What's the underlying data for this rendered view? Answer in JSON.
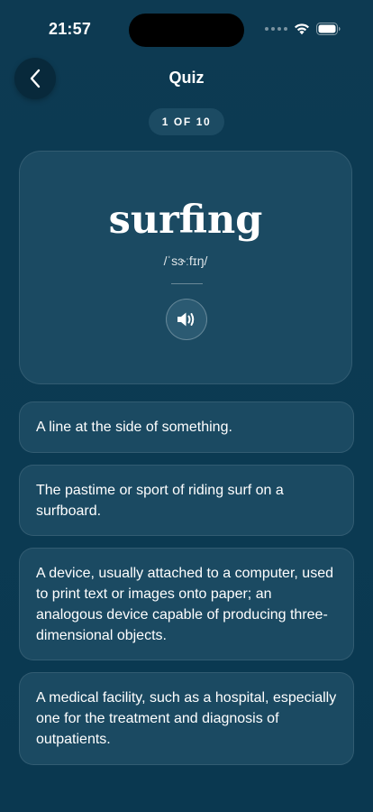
{
  "status_bar": {
    "time": "21:57"
  },
  "header": {
    "title": "Quiz",
    "progress": "1 OF 10"
  },
  "card": {
    "word": "surfing",
    "pronunciation": "/ˈsɝːfɪŋ/"
  },
  "options": [
    {
      "text": "A line at the side of something."
    },
    {
      "text": "The pastime or sport of riding surf on a surfboard."
    },
    {
      "text": "A device, usually attached to a computer, used to print text or images onto paper; an analogous device capable of producing three-dimensional objects."
    },
    {
      "text": "A medical facility, such as a hospital, especially one for the treatment and diagnosis of outpatients."
    }
  ],
  "icons": {
    "back": "chevron-left-icon",
    "speaker": "speaker-icon",
    "wifi": "wifi-icon",
    "battery": "battery-icon"
  },
  "colors": {
    "background": "#0c3b53",
    "card": "#1b4a62",
    "pill": "#1c4b63",
    "back_button": "#08293b"
  }
}
